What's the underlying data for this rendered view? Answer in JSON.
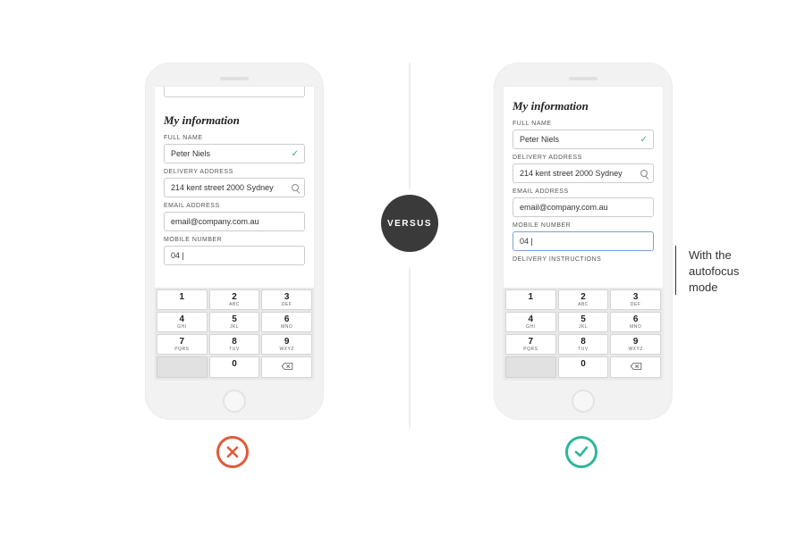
{
  "form": {
    "title": "My information",
    "labels": {
      "full_name": "FULL NAME",
      "delivery_address": "DELIVERY ADDRESS",
      "email_address": "EMAIL ADDRESS",
      "mobile_number": "MOBILE NUMBER",
      "delivery_instructions": "DELIVERY INSTRUCTIONS"
    },
    "values": {
      "full_name": "Peter Niels",
      "delivery_address": "214 kent street 2000 Sydney",
      "email_address": "email@company.com.au",
      "mobile_number": "04"
    }
  },
  "keypad": {
    "row1": [
      {
        "n": "1",
        "s": ""
      },
      {
        "n": "2",
        "s": "ABC"
      },
      {
        "n": "3",
        "s": "DEF"
      }
    ],
    "row2": [
      {
        "n": "4",
        "s": "GHI"
      },
      {
        "n": "5",
        "s": "JKL"
      },
      {
        "n": "6",
        "s": "MNO"
      }
    ],
    "row3": [
      {
        "n": "7",
        "s": "PQRS"
      },
      {
        "n": "8",
        "s": "TUV"
      },
      {
        "n": "9",
        "s": "WXYZ"
      }
    ],
    "row4_zero": {
      "n": "0",
      "s": ""
    }
  },
  "versus_label": "VERSUS",
  "annotation": {
    "line1": "With the",
    "line2": "autofocus",
    "line3": "mode"
  },
  "colors": {
    "versus_bg": "#3a3a3a",
    "bad": "#e25a3a",
    "good": "#2cb89a",
    "valid_check": "#36b26c"
  }
}
